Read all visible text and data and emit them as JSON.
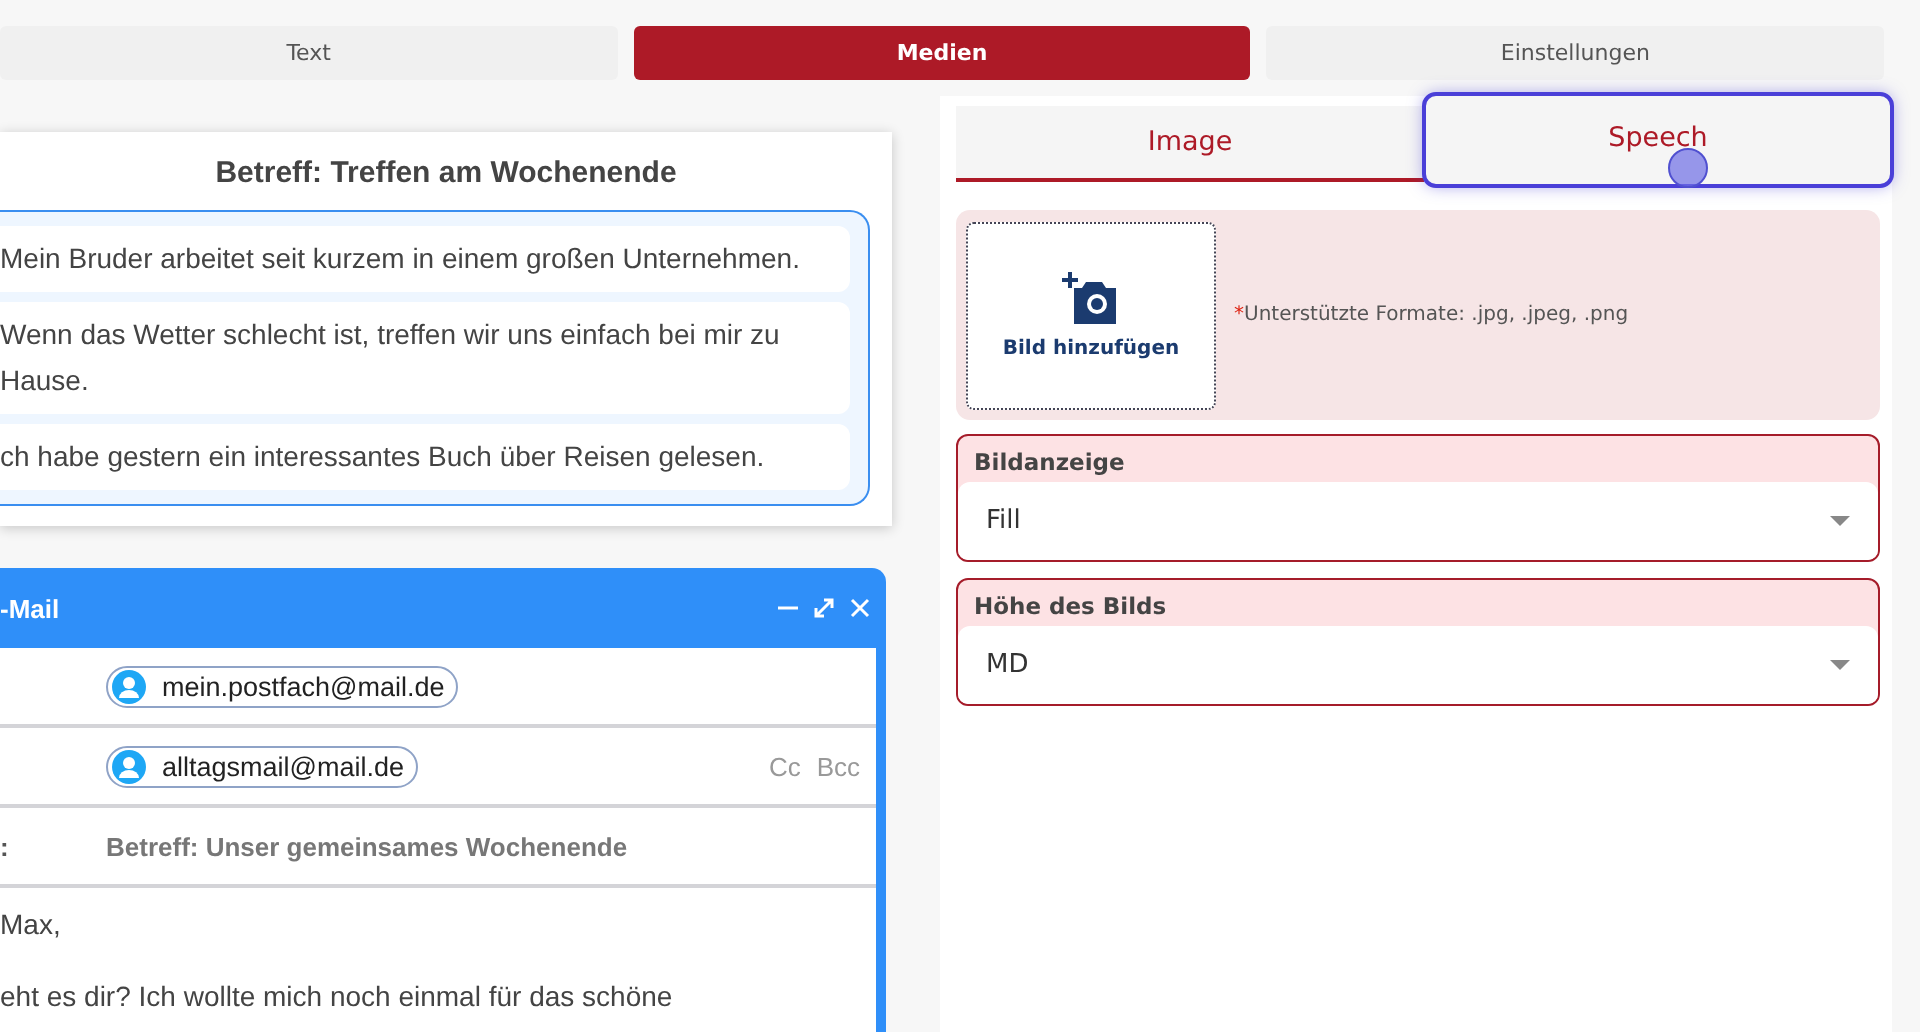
{
  "top_tabs": [
    {
      "label": "Text",
      "selected": false
    },
    {
      "label": "Medien",
      "selected": true
    },
    {
      "label": "Einstellungen",
      "selected": false
    }
  ],
  "exercise": {
    "title": "Betreff: Treffen am Wochenende",
    "sentences": [
      "Mein Bruder arbeitet seit kurzem in einem großen Unternehmen.",
      "Wenn das Wetter schlecht ist, treffen wir uns einfach bei mir zu Hause.",
      "ch habe gestern ein interessantes Buch über Reisen gelesen."
    ]
  },
  "email": {
    "title": "-Mail",
    "from": "mein.postfach@mail.de",
    "to": "alltagsmail@mail.de",
    "cc": "Cc",
    "bcc": "Bcc",
    "subject_label": ":",
    "subject": "Betreff: Unser gemeinsames Wochenende",
    "body": [
      "Max,",
      "eht es dir? Ich wollte mich noch einmal für das schöne"
    ]
  },
  "media_tabs": [
    {
      "label": "Image",
      "selected": true,
      "focused": false
    },
    {
      "label": "Speech",
      "selected": false,
      "focused": true
    }
  ],
  "upload": {
    "button": "Bild hinzufügen",
    "required_mark": "*",
    "hint": "Unterstützte Formate: .jpg, .jpeg, .png"
  },
  "selects": [
    {
      "label": "Bildanzeige",
      "value": "Fill"
    },
    {
      "label": "Höhe des Bilds",
      "value": "MD"
    }
  ]
}
